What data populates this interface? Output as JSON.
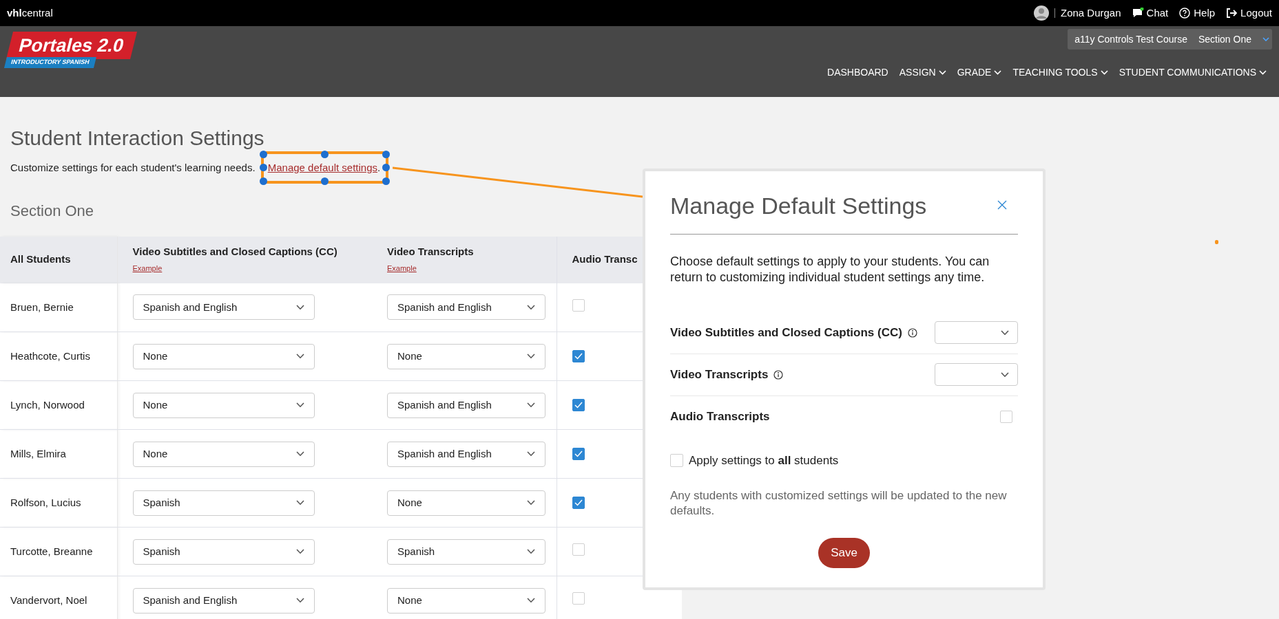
{
  "top_bar": {
    "brand": "**vhl**central",
    "user_name": "Zona Durgan",
    "links": [
      {
        "kind": "chat",
        "label": "Chat"
      },
      {
        "kind": "help",
        "label": "Help"
      },
      {
        "kind": "logout",
        "label": "Logout"
      }
    ]
  },
  "header": {
    "logo_title": "Portales 2.0",
    "logo_subtitle": "INTRODUCTORY SPANISH",
    "course_selector": {
      "course": "a11y Controls Test Course",
      "section": "Section One"
    },
    "nav": [
      {
        "label": "DASHBOARD",
        "dropdown": false
      },
      {
        "label": "ASSIGN",
        "dropdown": true
      },
      {
        "label": "GRADE",
        "dropdown": true
      },
      {
        "label": "TEACHING TOOLS",
        "dropdown": true
      },
      {
        "label": "STUDENT COMMUNICATIONS",
        "dropdown": true
      }
    ]
  },
  "page": {
    "title": "Student Interaction Settings",
    "description": {
      "text": "Customize settings for each student's learning needs.",
      "link": "Manage default settings",
      "end": "."
    },
    "section_title": "Section One"
  },
  "table": {
    "columns": [
      {
        "label": "All Students"
      },
      {
        "label": "Video Subtitles and Closed Captions (CC)",
        "example_link": "Example"
      },
      {
        "label": "Video Transcripts",
        "example_link": "Example"
      },
      {
        "label": "Audio Transc"
      }
    ],
    "rows": [
      {
        "name": "Bruen, Bernie",
        "subtitles": "Spanish and English",
        "transcripts": "Spanish and English",
        "audio_transcripts": false
      },
      {
        "name": "Heathcote, Curtis",
        "subtitles": "None",
        "transcripts": "None",
        "audio_transcripts": true
      },
      {
        "name": "Lynch, Norwood",
        "subtitles": "None",
        "transcripts": "Spanish and English",
        "audio_transcripts": true
      },
      {
        "name": "Mills, Elmira",
        "subtitles": "None",
        "transcripts": "Spanish and English",
        "audio_transcripts": true
      },
      {
        "name": "Rolfson, Lucius",
        "subtitles": "Spanish",
        "transcripts": "None",
        "audio_transcripts": true
      },
      {
        "name": "Turcotte, Breanne",
        "subtitles": "Spanish",
        "transcripts": "Spanish",
        "audio_transcripts": false
      },
      {
        "name": "Vandervort, Noel",
        "subtitles": "Spanish and English",
        "transcripts": "None",
        "audio_transcripts": false
      }
    ]
  },
  "modal": {
    "title": "Manage Default Settings",
    "description": "Choose default settings to apply to your students. You can return to customizing individual student settings any time.",
    "settings": [
      {
        "kind": "select",
        "label": "Video Subtitles and Closed Captions (CC)",
        "info": true
      },
      {
        "kind": "select",
        "label": "Video Transcripts",
        "info": true
      },
      {
        "kind": "checkbox",
        "label": "Audio Transcripts",
        "checked": false
      }
    ],
    "apply_all": {
      "label": "Apply settings to **all** students",
      "checked": false
    },
    "note": "Any students with customized settings will be updated to the new defaults.",
    "save_button": "Save"
  }
}
